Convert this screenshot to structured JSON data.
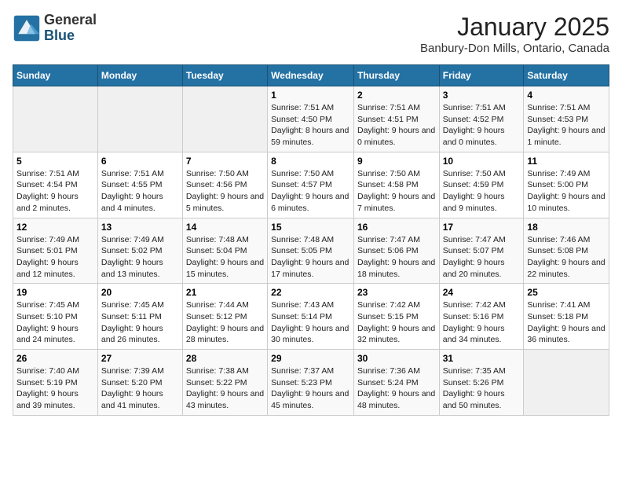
{
  "header": {
    "logo_general": "General",
    "logo_blue": "Blue",
    "month_title": "January 2025",
    "location": "Banbury-Don Mills, Ontario, Canada"
  },
  "days_of_week": [
    "Sunday",
    "Monday",
    "Tuesday",
    "Wednesday",
    "Thursday",
    "Friday",
    "Saturday"
  ],
  "weeks": [
    [
      {
        "day": "",
        "sunrise": "",
        "sunset": "",
        "daylight": "",
        "empty": true
      },
      {
        "day": "",
        "sunrise": "",
        "sunset": "",
        "daylight": "",
        "empty": true
      },
      {
        "day": "",
        "sunrise": "",
        "sunset": "",
        "daylight": "",
        "empty": true
      },
      {
        "day": "1",
        "sunrise": "Sunrise: 7:51 AM",
        "sunset": "Sunset: 4:50 PM",
        "daylight": "Daylight: 8 hours and 59 minutes."
      },
      {
        "day": "2",
        "sunrise": "Sunrise: 7:51 AM",
        "sunset": "Sunset: 4:51 PM",
        "daylight": "Daylight: 9 hours and 0 minutes."
      },
      {
        "day": "3",
        "sunrise": "Sunrise: 7:51 AM",
        "sunset": "Sunset: 4:52 PM",
        "daylight": "Daylight: 9 hours and 0 minutes."
      },
      {
        "day": "4",
        "sunrise": "Sunrise: 7:51 AM",
        "sunset": "Sunset: 4:53 PM",
        "daylight": "Daylight: 9 hours and 1 minute."
      }
    ],
    [
      {
        "day": "5",
        "sunrise": "Sunrise: 7:51 AM",
        "sunset": "Sunset: 4:54 PM",
        "daylight": "Daylight: 9 hours and 2 minutes."
      },
      {
        "day": "6",
        "sunrise": "Sunrise: 7:51 AM",
        "sunset": "Sunset: 4:55 PM",
        "daylight": "Daylight: 9 hours and 4 minutes."
      },
      {
        "day": "7",
        "sunrise": "Sunrise: 7:50 AM",
        "sunset": "Sunset: 4:56 PM",
        "daylight": "Daylight: 9 hours and 5 minutes."
      },
      {
        "day": "8",
        "sunrise": "Sunrise: 7:50 AM",
        "sunset": "Sunset: 4:57 PM",
        "daylight": "Daylight: 9 hours and 6 minutes."
      },
      {
        "day": "9",
        "sunrise": "Sunrise: 7:50 AM",
        "sunset": "Sunset: 4:58 PM",
        "daylight": "Daylight: 9 hours and 7 minutes."
      },
      {
        "day": "10",
        "sunrise": "Sunrise: 7:50 AM",
        "sunset": "Sunset: 4:59 PM",
        "daylight": "Daylight: 9 hours and 9 minutes."
      },
      {
        "day": "11",
        "sunrise": "Sunrise: 7:49 AM",
        "sunset": "Sunset: 5:00 PM",
        "daylight": "Daylight: 9 hours and 10 minutes."
      }
    ],
    [
      {
        "day": "12",
        "sunrise": "Sunrise: 7:49 AM",
        "sunset": "Sunset: 5:01 PM",
        "daylight": "Daylight: 9 hours and 12 minutes."
      },
      {
        "day": "13",
        "sunrise": "Sunrise: 7:49 AM",
        "sunset": "Sunset: 5:02 PM",
        "daylight": "Daylight: 9 hours and 13 minutes."
      },
      {
        "day": "14",
        "sunrise": "Sunrise: 7:48 AM",
        "sunset": "Sunset: 5:04 PM",
        "daylight": "Daylight: 9 hours and 15 minutes."
      },
      {
        "day": "15",
        "sunrise": "Sunrise: 7:48 AM",
        "sunset": "Sunset: 5:05 PM",
        "daylight": "Daylight: 9 hours and 17 minutes."
      },
      {
        "day": "16",
        "sunrise": "Sunrise: 7:47 AM",
        "sunset": "Sunset: 5:06 PM",
        "daylight": "Daylight: 9 hours and 18 minutes."
      },
      {
        "day": "17",
        "sunrise": "Sunrise: 7:47 AM",
        "sunset": "Sunset: 5:07 PM",
        "daylight": "Daylight: 9 hours and 20 minutes."
      },
      {
        "day": "18",
        "sunrise": "Sunrise: 7:46 AM",
        "sunset": "Sunset: 5:08 PM",
        "daylight": "Daylight: 9 hours and 22 minutes."
      }
    ],
    [
      {
        "day": "19",
        "sunrise": "Sunrise: 7:45 AM",
        "sunset": "Sunset: 5:10 PM",
        "daylight": "Daylight: 9 hours and 24 minutes."
      },
      {
        "day": "20",
        "sunrise": "Sunrise: 7:45 AM",
        "sunset": "Sunset: 5:11 PM",
        "daylight": "Daylight: 9 hours and 26 minutes."
      },
      {
        "day": "21",
        "sunrise": "Sunrise: 7:44 AM",
        "sunset": "Sunset: 5:12 PM",
        "daylight": "Daylight: 9 hours and 28 minutes."
      },
      {
        "day": "22",
        "sunrise": "Sunrise: 7:43 AM",
        "sunset": "Sunset: 5:14 PM",
        "daylight": "Daylight: 9 hours and 30 minutes."
      },
      {
        "day": "23",
        "sunrise": "Sunrise: 7:42 AM",
        "sunset": "Sunset: 5:15 PM",
        "daylight": "Daylight: 9 hours and 32 minutes."
      },
      {
        "day": "24",
        "sunrise": "Sunrise: 7:42 AM",
        "sunset": "Sunset: 5:16 PM",
        "daylight": "Daylight: 9 hours and 34 minutes."
      },
      {
        "day": "25",
        "sunrise": "Sunrise: 7:41 AM",
        "sunset": "Sunset: 5:18 PM",
        "daylight": "Daylight: 9 hours and 36 minutes."
      }
    ],
    [
      {
        "day": "26",
        "sunrise": "Sunrise: 7:40 AM",
        "sunset": "Sunset: 5:19 PM",
        "daylight": "Daylight: 9 hours and 39 minutes."
      },
      {
        "day": "27",
        "sunrise": "Sunrise: 7:39 AM",
        "sunset": "Sunset: 5:20 PM",
        "daylight": "Daylight: 9 hours and 41 minutes."
      },
      {
        "day": "28",
        "sunrise": "Sunrise: 7:38 AM",
        "sunset": "Sunset: 5:22 PM",
        "daylight": "Daylight: 9 hours and 43 minutes."
      },
      {
        "day": "29",
        "sunrise": "Sunrise: 7:37 AM",
        "sunset": "Sunset: 5:23 PM",
        "daylight": "Daylight: 9 hours and 45 minutes."
      },
      {
        "day": "30",
        "sunrise": "Sunrise: 7:36 AM",
        "sunset": "Sunset: 5:24 PM",
        "daylight": "Daylight: 9 hours and 48 minutes."
      },
      {
        "day": "31",
        "sunrise": "Sunrise: 7:35 AM",
        "sunset": "Sunset: 5:26 PM",
        "daylight": "Daylight: 9 hours and 50 minutes."
      },
      {
        "day": "",
        "sunrise": "",
        "sunset": "",
        "daylight": "",
        "empty": true
      }
    ]
  ]
}
